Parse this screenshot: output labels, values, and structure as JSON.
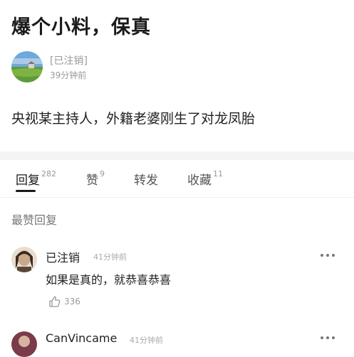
{
  "post": {
    "title": "爆个小料，保真",
    "body": "央视某主持人，外籍老婆刚生了对龙凤胎"
  },
  "author": {
    "name": "[已注销]",
    "time": "39分钟前",
    "avatar_icon": "landscape-avatar-icon"
  },
  "tabs": [
    {
      "label": "回复",
      "count": "282",
      "active": true
    },
    {
      "label": "赞",
      "count": "9",
      "active": false
    },
    {
      "label": "转发",
      "count": "",
      "active": false
    },
    {
      "label": "收藏",
      "count": "11",
      "active": false
    }
  ],
  "section": {
    "heading": "最赞回复"
  },
  "comments": [
    {
      "user": "已注销",
      "time": "41分钟前",
      "text": "如果是真的，就恭喜恭喜",
      "likes": "336",
      "more_icon": "ellipsis-icon",
      "like_icon": "thumbs-up-icon"
    },
    {
      "user": "CanVincame",
      "time": "41分钟前"
    }
  ],
  "colors": {
    "title": "#1a1a1a",
    "muted": "#999999",
    "divider": "#f4f4f4",
    "active_tab": "#1a1a1a"
  }
}
